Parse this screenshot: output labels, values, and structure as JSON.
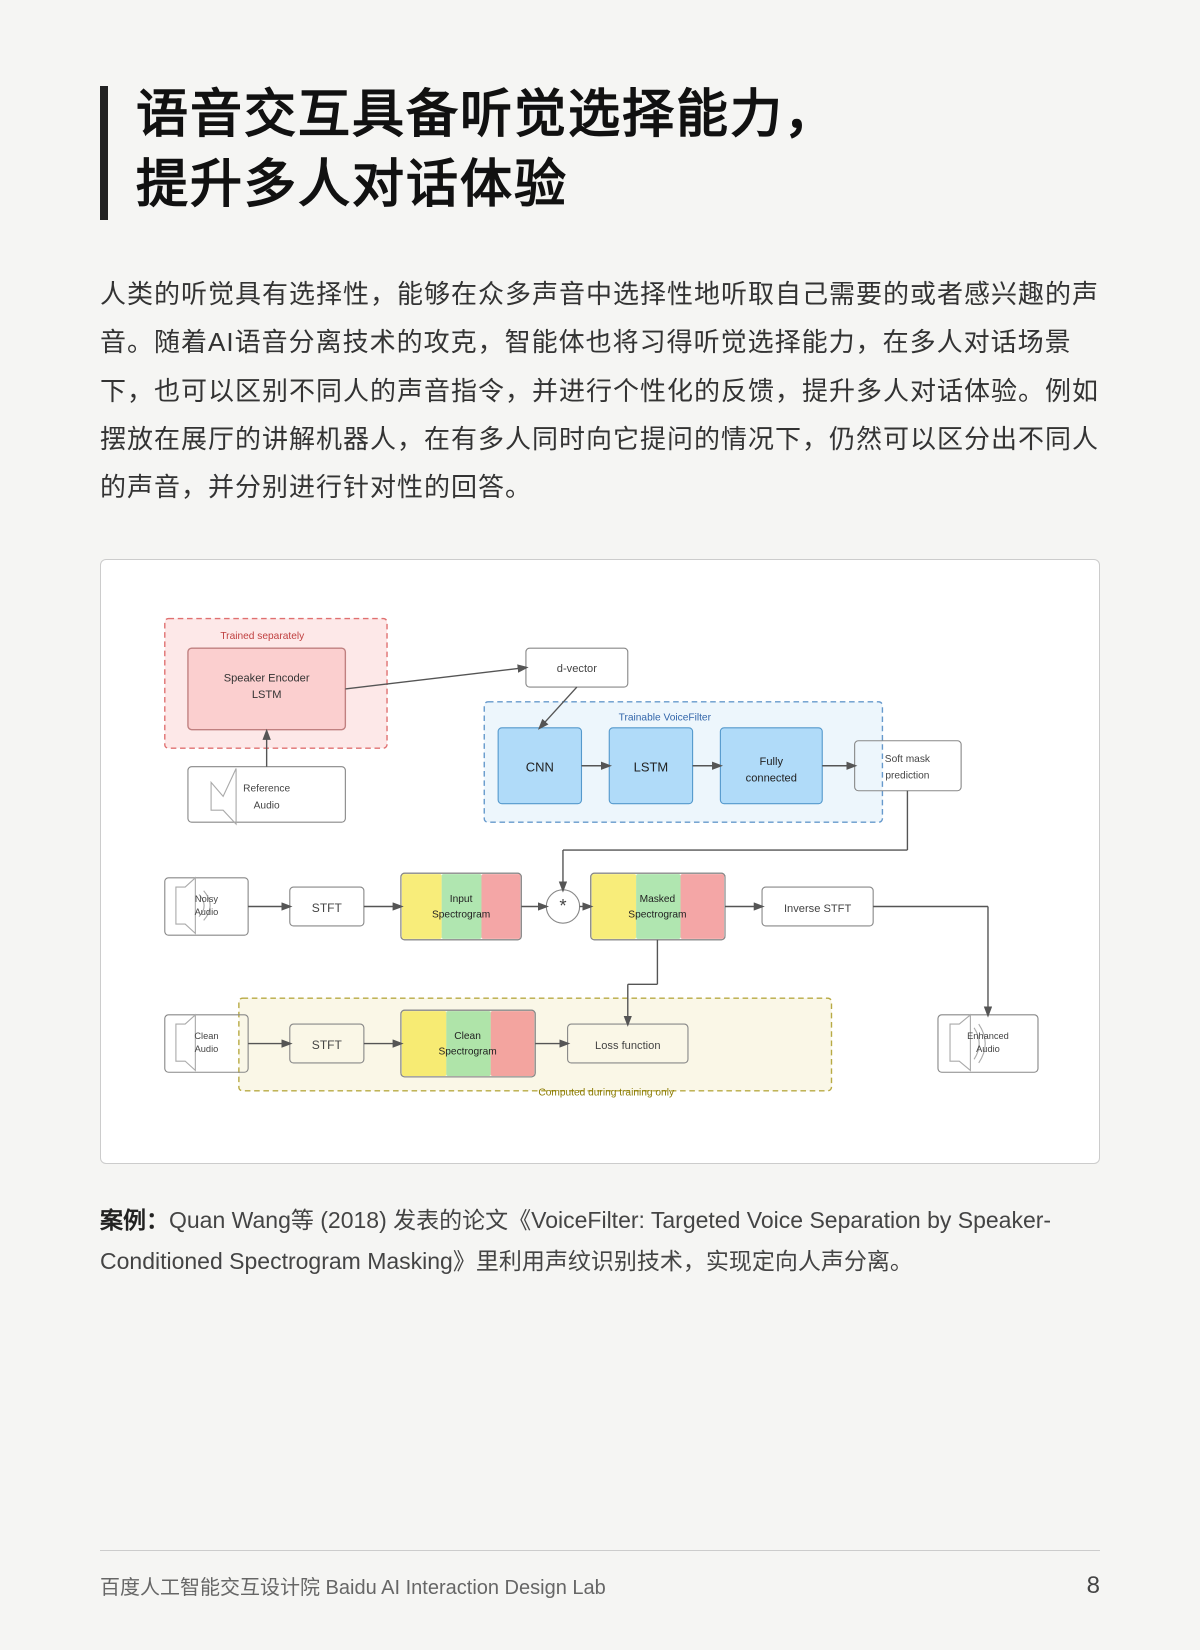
{
  "title": {
    "bar_color": "#111111",
    "line1": "语音交互具备听觉选择能力，",
    "line2": "提升多人对话体验"
  },
  "body": {
    "paragraph": "人类的听觉具有选择性，能够在众多声音中选择性地听取自己需要的或者感兴趣的声音。随着AI语音分离技术的攻克，智能体也将习得听觉选择能力，在多人对话场景下，也可以区别不同人的声音指令，并进行个性化的反馈，提升多人对话体验。例如摆放在展厅的讲解机器人，在有多人同时向它提问的情况下，仍然可以区分出不同人的声音，并分别进行针对性的回答。"
  },
  "diagram": {
    "nodes": {
      "trained_separately": "Trained separately",
      "speaker_encoder": "Speaker Encoder\nLSTM",
      "reference_audio": "Reference\nAudio",
      "d_vector": "d-vector",
      "trainable_voicefilter": "Trainable VoiceFilter",
      "cnn": "CNN",
      "lstm": "LSTM",
      "fully_connected": "Fully\nconnected",
      "soft_mask": "Soft mask\nprediction",
      "noisy_audio": "Noisy\nAudio",
      "stft1": "STFT",
      "input_spectrogram": "Input\nSpectrogram",
      "asterisk": "*",
      "masked_spectrogram": "Masked\nSpectrogram",
      "inverse_stft": "Inverse STFT",
      "clean_audio": "Clean\nAudio",
      "stft2": "STFT",
      "clean_spectrogram": "Clean\nSpectrogram",
      "loss_function": "Loss function",
      "computed_during": "Computed during training only",
      "enhanced_audio": "Enhanced\nAudio"
    }
  },
  "caption": {
    "prefix": "案例：",
    "text": "Quan Wang等 (2018) 发表的论文《VoiceFilter: Targeted Voice Separation by Speaker-Conditioned Spectrogram Masking》里利用声纹识别技术，实现定向人声分离。"
  },
  "footer": {
    "left": "百度人工智能交互设计院  Baidu AI Interaction Design Lab",
    "page": "8"
  }
}
